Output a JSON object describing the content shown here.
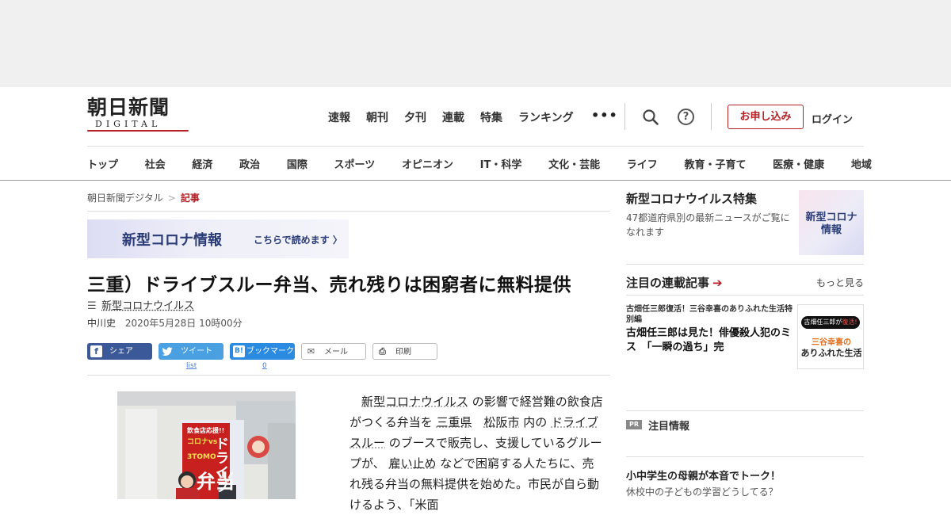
{
  "header": {
    "logo_main": "朝日新聞",
    "logo_sub": "DIGITAL",
    "top_nav": [
      "速報",
      "朝刊",
      "夕刊",
      "連載",
      "特集",
      "ランキング"
    ],
    "more_label": "•••",
    "help_label": "?",
    "apply_label": "お申し込み",
    "login_label": "ログイン",
    "category_nav": [
      "トップ",
      "社会",
      "経済",
      "政治",
      "国際",
      "スポーツ",
      "オピニオン",
      "IT・科学",
      "文化・芸能",
      "ライフ",
      "教育・子育て",
      "医療・健康",
      "地域"
    ]
  },
  "breadcrumb": {
    "home": "朝日新聞デジタル",
    "separator": ">",
    "current": "記事"
  },
  "banner": {
    "title": "新型コロナ情報",
    "link": "こちらで読めます 〉"
  },
  "article": {
    "headline": "三重）ドライブスルー弁当、売れ残りは困窮者に無料提供",
    "tag": "新型コロナウイルス",
    "author": "中川史",
    "date": "2020年5月28日 10時00分",
    "share": {
      "facebook": "シェア",
      "twitter": "ツイート",
      "twitter_count": "list",
      "hatena": "ブックマーク",
      "hatena_icon": "B!",
      "hatena_count": "0",
      "mail": "メール",
      "print": "印刷"
    },
    "photo_text": {
      "sign1": "飲食店応援!!",
      "sign2": "コロナvs",
      "sign3": "3TOMO",
      "sign4": "ドライブ",
      "sign5": "弁当"
    },
    "body": {
      "p1_kw1": "新型コロナウイルス",
      "p1_t1": " の影響で経営難の飲食店がつくる弁当を ",
      "p1_kw2": "三重県",
      "p1_kw3": "松阪市",
      "p1_t2": " 内の ",
      "p1_kw4": "ドライブスルー",
      "p1_t3": " のブースで販売し、支援しているグループが、 ",
      "p1_kw5": "雇い止め",
      "p1_t4": " などで困窮する人たちに、売れ残る弁当の無料提供を始めた。",
      "p1_t5": "市民が自ら動けるよう、「米面"
    }
  },
  "sidebar": {
    "feature_title": "新型コロナウイルス特集",
    "feature_desc": "47都道府県別の最新ニュースがご覧になれます",
    "feature_thumb": "新型コロナ\n情報",
    "serial_title": "注目の連載記事",
    "serial_arrow": "➔",
    "serial_more": "もっと見る",
    "serial_series": "古畑任三郎復活！三谷幸喜のありふれた生活特別編",
    "serial_headline": "古畑任三郎は見た！俳優殺人犯のミス　「一瞬の過ち」完",
    "serial_thumb_1a": "古畑任三郎が",
    "serial_thumb_1b": "復活!",
    "serial_thumb_2": "三谷幸喜の",
    "serial_thumb_3": "ありふれた生活",
    "pr_badge": "PR",
    "pr_label": "注目情報",
    "pr_title": "小中学生の母親が本音でトーク！",
    "pr_sub": "休校中の子どもの学習どうしてる？"
  },
  "colors": {
    "brand_red": "#b51f24",
    "facebook": "#3b5998",
    "twitter": "#4aa0e0",
    "hatena": "#2a8be0",
    "navy": "#2a3c78"
  }
}
